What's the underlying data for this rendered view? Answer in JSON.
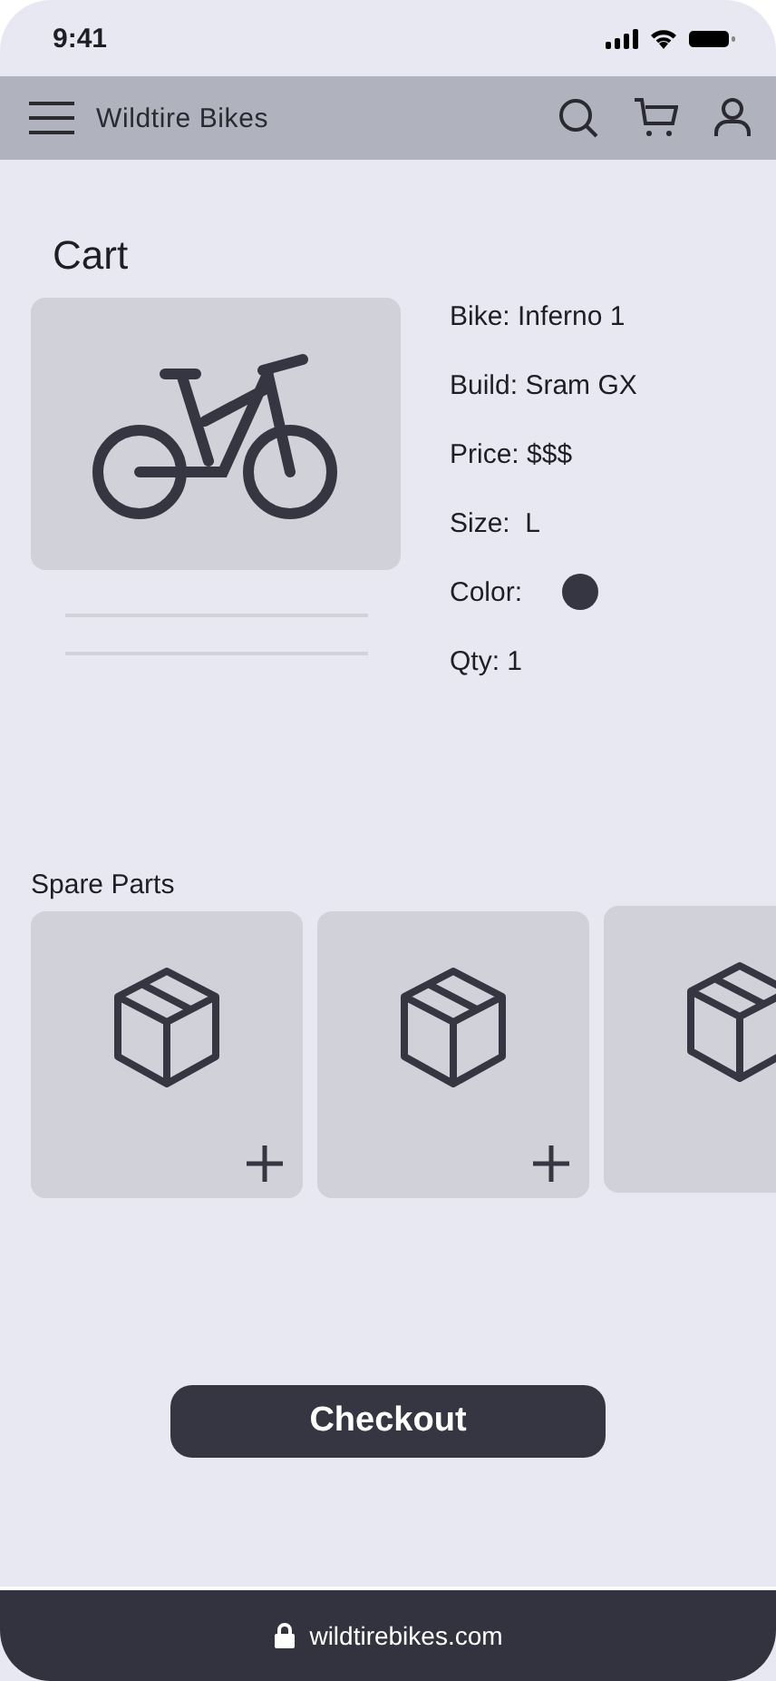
{
  "status_bar": {
    "time": "9:41"
  },
  "nav": {
    "title": "Wildtire Bikes"
  },
  "cart": {
    "title": "Cart",
    "details": [
      {
        "kind": "text",
        "text": "Bike: Inferno 1"
      },
      {
        "kind": "text",
        "text": "Build: Sram GX"
      },
      {
        "kind": "text",
        "text": "Price: $$$"
      },
      {
        "kind": "text",
        "text": "Size:  L"
      },
      {
        "kind": "swatch",
        "text": "Color:",
        "color": "#363642"
      },
      {
        "kind": "text",
        "text": "Qty: 1"
      }
    ]
  },
  "spare_parts": {
    "title": "Spare Parts",
    "items": [
      {
        "kind": "part"
      },
      {
        "kind": "part"
      },
      {
        "kind": "part"
      }
    ]
  },
  "checkout": {
    "label": "Checkout"
  },
  "address_bar": {
    "url": "wildtirebikes.com"
  }
}
